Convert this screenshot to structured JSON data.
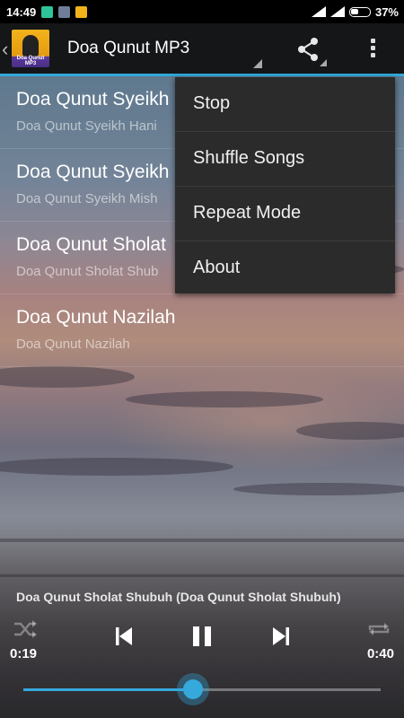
{
  "status_bar": {
    "time": "14:49",
    "battery_percent": "37%"
  },
  "action_bar": {
    "logo_caption": "Doa Qunut MP3",
    "title": "Doa Qunut MP3"
  },
  "tracks": [
    {
      "title": "Doa Qunut Syeikh",
      "subtitle": "Doa Qunut Syeikh Hani"
    },
    {
      "title": "Doa Qunut Syeikh",
      "subtitle": "Doa Qunut Syeikh Mish"
    },
    {
      "title": "Doa Qunut Sholat",
      "subtitle": "Doa Qunut Sholat Shub"
    },
    {
      "title": "Doa Qunut Nazilah",
      "subtitle": "Doa Qunut Nazilah"
    }
  ],
  "menu": {
    "items": [
      "Stop",
      "Shuffle Songs",
      "Repeat Mode",
      "About"
    ]
  },
  "player": {
    "now_playing": "Doa Qunut Sholat Shubuh (Doa Qunut Sholat Shubuh)",
    "elapsed": "0:19",
    "duration": "0:40",
    "progress_fraction": 0.475
  },
  "colors": {
    "accent": "#35a9dc"
  }
}
